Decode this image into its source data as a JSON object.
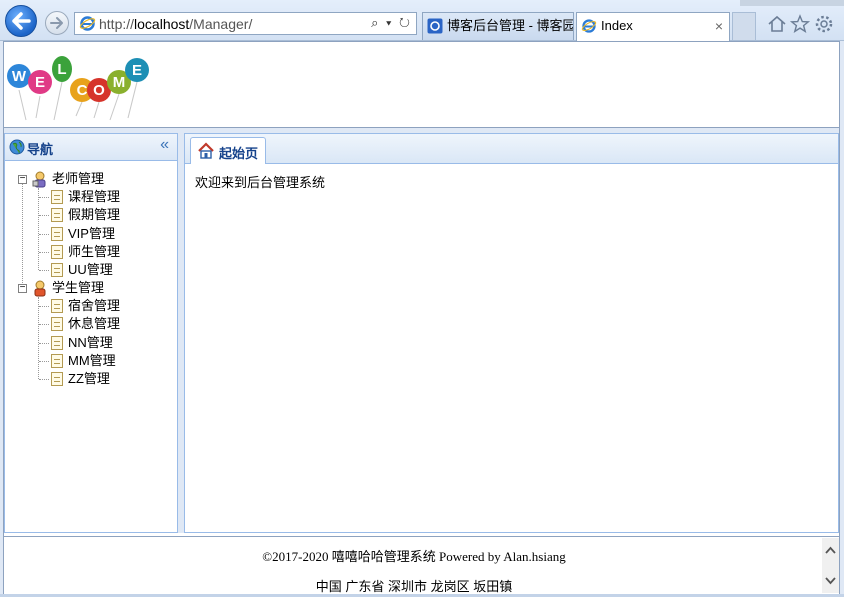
{
  "browser": {
    "url_prefix": "http://",
    "url_host": "localhost",
    "url_path": "/Manager/",
    "address_tools": "⌕ ▾ ↻",
    "tabs": [
      {
        "label": "博客后台管理 - 博客园"
      },
      {
        "label": "Index",
        "close": "×"
      }
    ]
  },
  "nav": {
    "title": "导航",
    "collapse": "«",
    "groups": [
      {
        "label": "老师管理",
        "toggle": "−",
        "items": [
          "课程管理",
          "假期管理",
          "VIP管理",
          "师生管理",
          "UU管理"
        ]
      },
      {
        "label": "学生管理",
        "toggle": "−",
        "items": [
          "宿舍管理",
          "休息管理",
          "NN管理",
          "MM管理",
          "ZZ管理"
        ]
      }
    ]
  },
  "content": {
    "tab_label": "起始页",
    "welcome_text": "欢迎来到后台管理系统"
  },
  "footer": {
    "line1": "©2017-2020 嘻嘻哈哈管理系统 Powered by Alan.hsiang",
    "line2": "中国 广东省 深圳市 龙岗区 坂田镇"
  },
  "logo": {
    "letters": [
      "W",
      "E",
      "L",
      "C",
      "O",
      "M",
      "E"
    ]
  },
  "icons": [
    "back-arrow-icon",
    "forward-arrow-icon",
    "ie-logo-icon",
    "home-icon",
    "star-icon",
    "gear-icon",
    "globe-icon",
    "teacher-icon",
    "student-icon",
    "page-icon",
    "house-icon"
  ],
  "colors": {
    "panel_border": "#99bbe8",
    "header_text": "#15428b",
    "chrome_bg": "#dfe8f5"
  }
}
